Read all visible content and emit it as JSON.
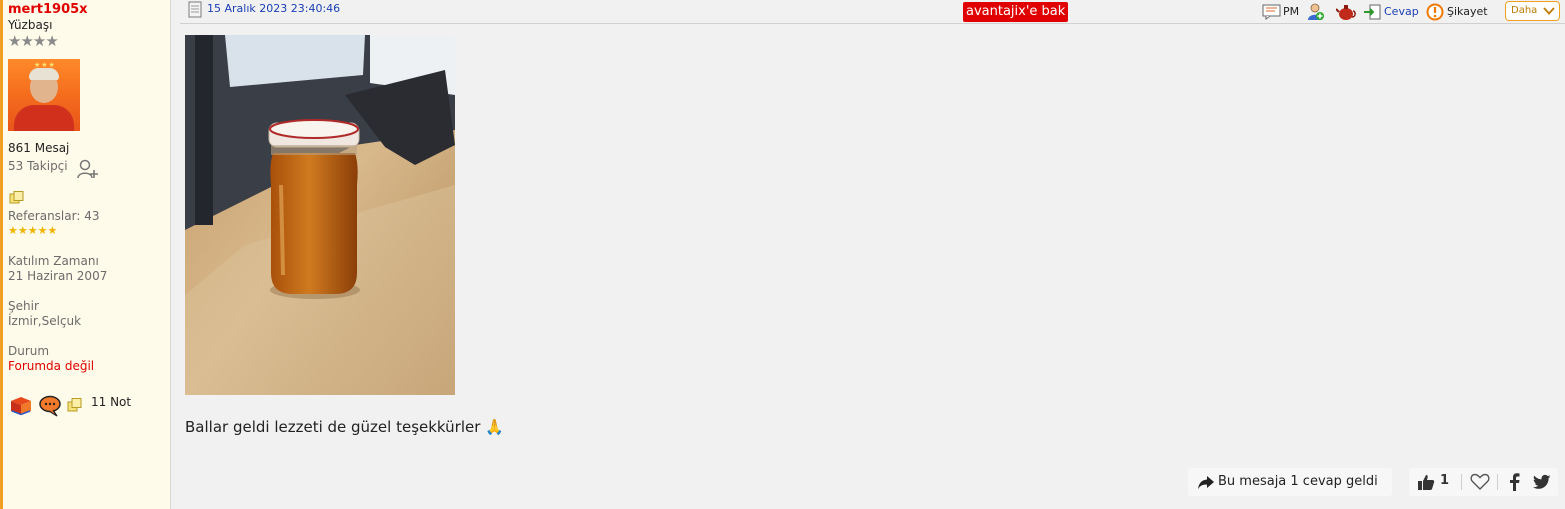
{
  "user": {
    "name": "mert1905x",
    "rank": "Yüzbaşı",
    "stars": "★★★★",
    "messages": "861 Mesaj",
    "followers": "53 Takipçi",
    "references": "Referanslar: 43",
    "medals": "★★★★★",
    "join_label": "Katılım Zamanı",
    "join_date": "21 Haziran 2007",
    "city_label": "Şehir",
    "city": "İzmir,Selçuk",
    "status_label": "Durum",
    "status": "Forumda değil",
    "notes": "11 Not"
  },
  "post": {
    "date": "15 Aralık 2023 23:40:46",
    "message": "Ballar geldi lezzeti de güzel teşekkürler",
    "emoji": "🙏"
  },
  "actions": {
    "avantaj": "avantajix'e bak",
    "pm": "PM",
    "reply": "Cevap",
    "report": "Şikayet",
    "more": "Daha"
  },
  "footer": {
    "reply_count": "Bu mesaja 1 cevap geldi",
    "likes": "1"
  },
  "colors": {
    "username": "#e00000",
    "link": "#1a3fb6",
    "accent": "#f0a020",
    "sidebar_bg": "#fffbea"
  }
}
